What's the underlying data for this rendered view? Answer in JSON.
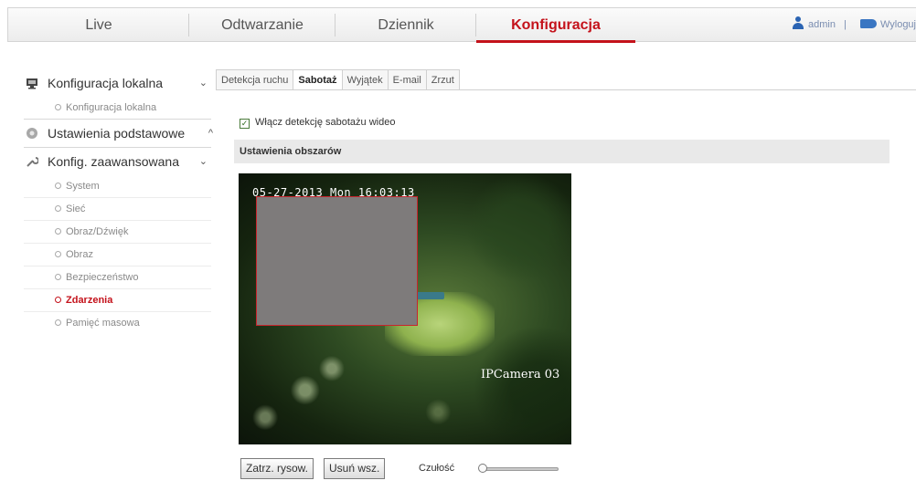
{
  "topnav": {
    "tabs": [
      "Live",
      "Odtwarzanie",
      "Dziennik",
      "Konfiguracja"
    ],
    "active_tab": "Konfiguracja",
    "user": "admin",
    "separator": "|",
    "logout": "Wyloguj"
  },
  "sidebar": {
    "sections": [
      {
        "label": "Konfiguracja lokalna",
        "icon": "monitor-icon",
        "chevron": "⌄",
        "items": [
          "Konfiguracja lokalna"
        ]
      },
      {
        "label": "Ustawienia podstawowe",
        "icon": "gear-icon",
        "chevron": "^",
        "items": []
      },
      {
        "label": "Konfig. zaawansowana",
        "icon": "wrench-icon",
        "chevron": "⌄",
        "items": [
          "System",
          "Sieć",
          "Obraz/Dźwięk",
          "Obraz",
          "Bezpieczeństwo",
          "Zdarzenia",
          "Pamięć masowa"
        ]
      }
    ],
    "active_item": "Zdarzenia"
  },
  "subtabs": {
    "items": [
      "Detekcja ruchu",
      "Sabotaż",
      "Wyjątek",
      "E-mail",
      "Zrzut"
    ],
    "active": "Sabotaż"
  },
  "tamper": {
    "enable_label": "Włącz detekcję sabotażu wideo",
    "enabled": true,
    "area_header": "Ustawienia obszarów",
    "osd_time": "05-27-2013 Mon 16:03:13",
    "osd_camera": "IPCamera 03",
    "draw_button": "Zatrz. rysow.",
    "clear_button": "Usuń wsz.",
    "sensitivity_label": "Czułość",
    "sensitivity": 0
  },
  "colors": {
    "accent": "#c4121b",
    "link_blue": "#2b64b3"
  }
}
